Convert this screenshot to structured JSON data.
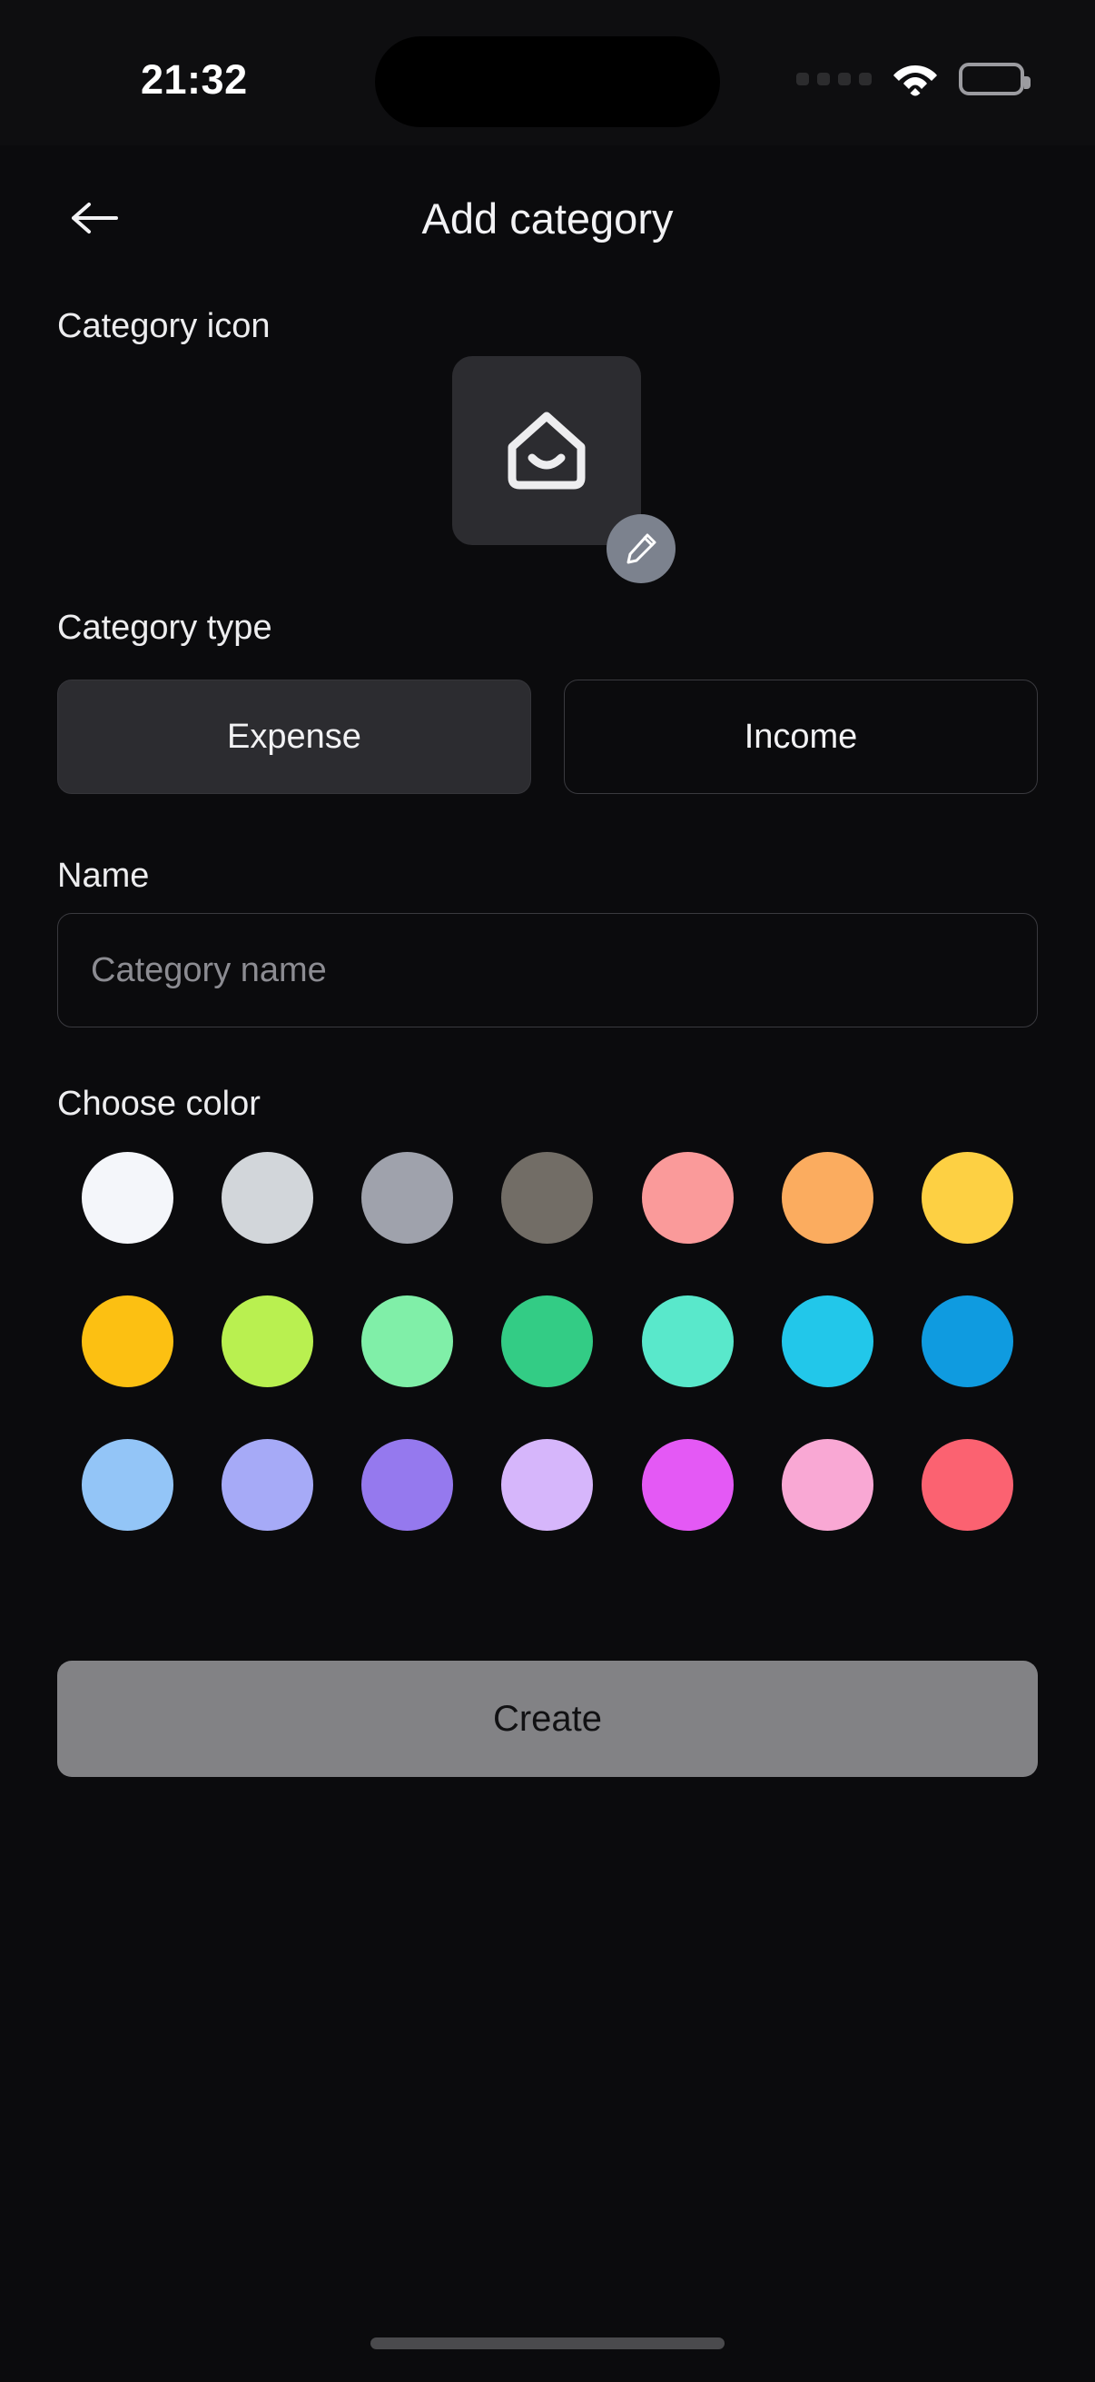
{
  "status_bar": {
    "time": "21:32",
    "signal_icon": "signal-dots-icon",
    "wifi_icon": "wifi-icon",
    "battery_icon": "battery-full-icon"
  },
  "header": {
    "back_icon": "arrow-left-icon",
    "title": "Add category"
  },
  "sections": {
    "category_icon_label": "Category icon",
    "category_type_label": "Category type",
    "name_label": "Name",
    "choose_color_label": "Choose color"
  },
  "category_icon": {
    "icon": "home-icon",
    "tile_color": "#2C2C30",
    "edit_badge_icon": "pencil-icon",
    "edit_badge_color": "#7C828E"
  },
  "category_type": {
    "options": [
      {
        "label": "Expense",
        "selected": true
      },
      {
        "label": "Income",
        "selected": false
      }
    ],
    "selected_value": "Expense"
  },
  "name_input": {
    "value": "",
    "placeholder": "Category name"
  },
  "colors": {
    "selected": null,
    "swatches": [
      "#F4F6FA",
      "#D2D6DA",
      "#9FA2AC",
      "#726D66",
      "#FA9A9A",
      "#FBAC5F",
      "#FDD043",
      "#FCC012",
      "#B9F050",
      "#80EFA8",
      "#33CC85",
      "#59E8CB",
      "#22C7EA",
      "#0F9BE0",
      "#93C5F7",
      "#A6AAF7",
      "#9579EE",
      "#D6B6FB",
      "#E459F5",
      "#F9A8D4",
      "#FB6271"
    ]
  },
  "footer": {
    "create_label": "Create",
    "create_color": "#828285"
  }
}
